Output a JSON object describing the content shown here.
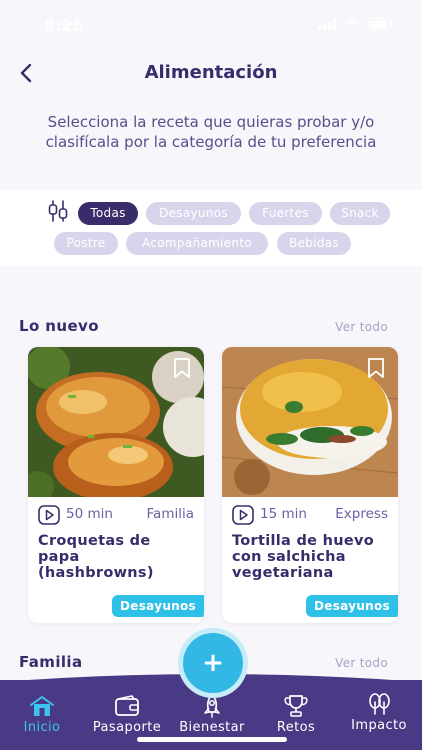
{
  "status": {
    "time": "8:26"
  },
  "header": {
    "title": "Alimentación"
  },
  "intro": {
    "text": "Selecciona la receta que quieras probar y/o clasifícala por la categoría de tu preferencia"
  },
  "filters": {
    "icon": "sliders-icon",
    "chips": [
      "Todas",
      "Desayunos",
      "Fuertes",
      "Snack",
      "Postre",
      "Acompañamiento",
      "Bebidas"
    ],
    "active": "Todas"
  },
  "sections": [
    {
      "title": "Lo nuevo",
      "see_all": "Ver todo"
    },
    {
      "title": "Familia",
      "see_all": "Ver todo"
    }
  ],
  "recipes": [
    {
      "duration": "50 min",
      "category": "Familia",
      "title": "Croquetas de papa (hashbrowns)",
      "tag": "Desayunos",
      "image": "hashbrown-photo"
    },
    {
      "duration": "15 min",
      "category": "Express",
      "title": "Tortilla de huevo con salchicha vegetariana",
      "tag": "Desayunos",
      "image": "omelette-photo"
    }
  ],
  "fab": {
    "label": "+"
  },
  "nav": {
    "items": [
      {
        "label": "Inicio",
        "icon": "home-icon",
        "active": true
      },
      {
        "label": "Pasaporte",
        "icon": "wallet-icon",
        "active": false
      },
      {
        "label": "Bienestar",
        "icon": "rocket-icon",
        "active": false
      },
      {
        "label": "Retos",
        "icon": "trophy-icon",
        "active": false
      },
      {
        "label": "Impacto",
        "icon": "trees-icon",
        "active": false
      }
    ]
  },
  "colors": {
    "primary": "#3a2c6b",
    "accent": "#33b8e6",
    "chip": "#d9d4ec",
    "nav": "#4a3a85"
  }
}
